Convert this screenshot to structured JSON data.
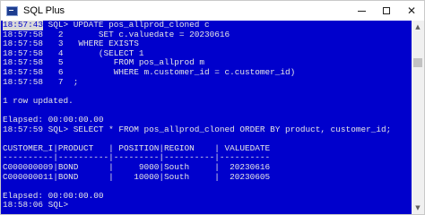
{
  "window": {
    "title": "SQL Plus",
    "minimize_label": "—",
    "maximize_label": "□",
    "close_label": "✕",
    "icon": "sqlplus-app-icon"
  },
  "console": {
    "background": "#0000cc",
    "text_color": "#e6e6e6",
    "lines": [
      "18:57:43 SQL> UPDATE pos_allprod_cloned c",
      "18:57:58   2       SET c.valuedate = 20230616",
      "18:57:58   3   WHERE EXISTS",
      "18:57:58   4       (SELECT 1",
      "18:57:58   5          FROM pos_allprod m",
      "18:57:58   6          WHERE m.customer_id = c.customer_id)",
      "18:57:58   7  ;",
      "",
      "1 row updated.",
      "",
      "Elapsed: 00:00:00.00",
      "18:57:59 SQL> SELECT * FROM pos_allprod_cloned ORDER BY product, customer_id;",
      "",
      "CUSTOMER_I|PRODUCT   | POSITION|REGION    | VALUEDATE",
      "----------|----------|---------|----------|----------",
      "C000000009|BOND      |     9000|South     |  20230616",
      "C000000011|BOND      |    10000|South     |  20230605",
      "",
      "Elapsed: 00:00:00.00",
      "18:58:06 SQL>"
    ]
  },
  "scrollbar": {
    "up_arrow": "▲",
    "down_arrow": "▼"
  }
}
